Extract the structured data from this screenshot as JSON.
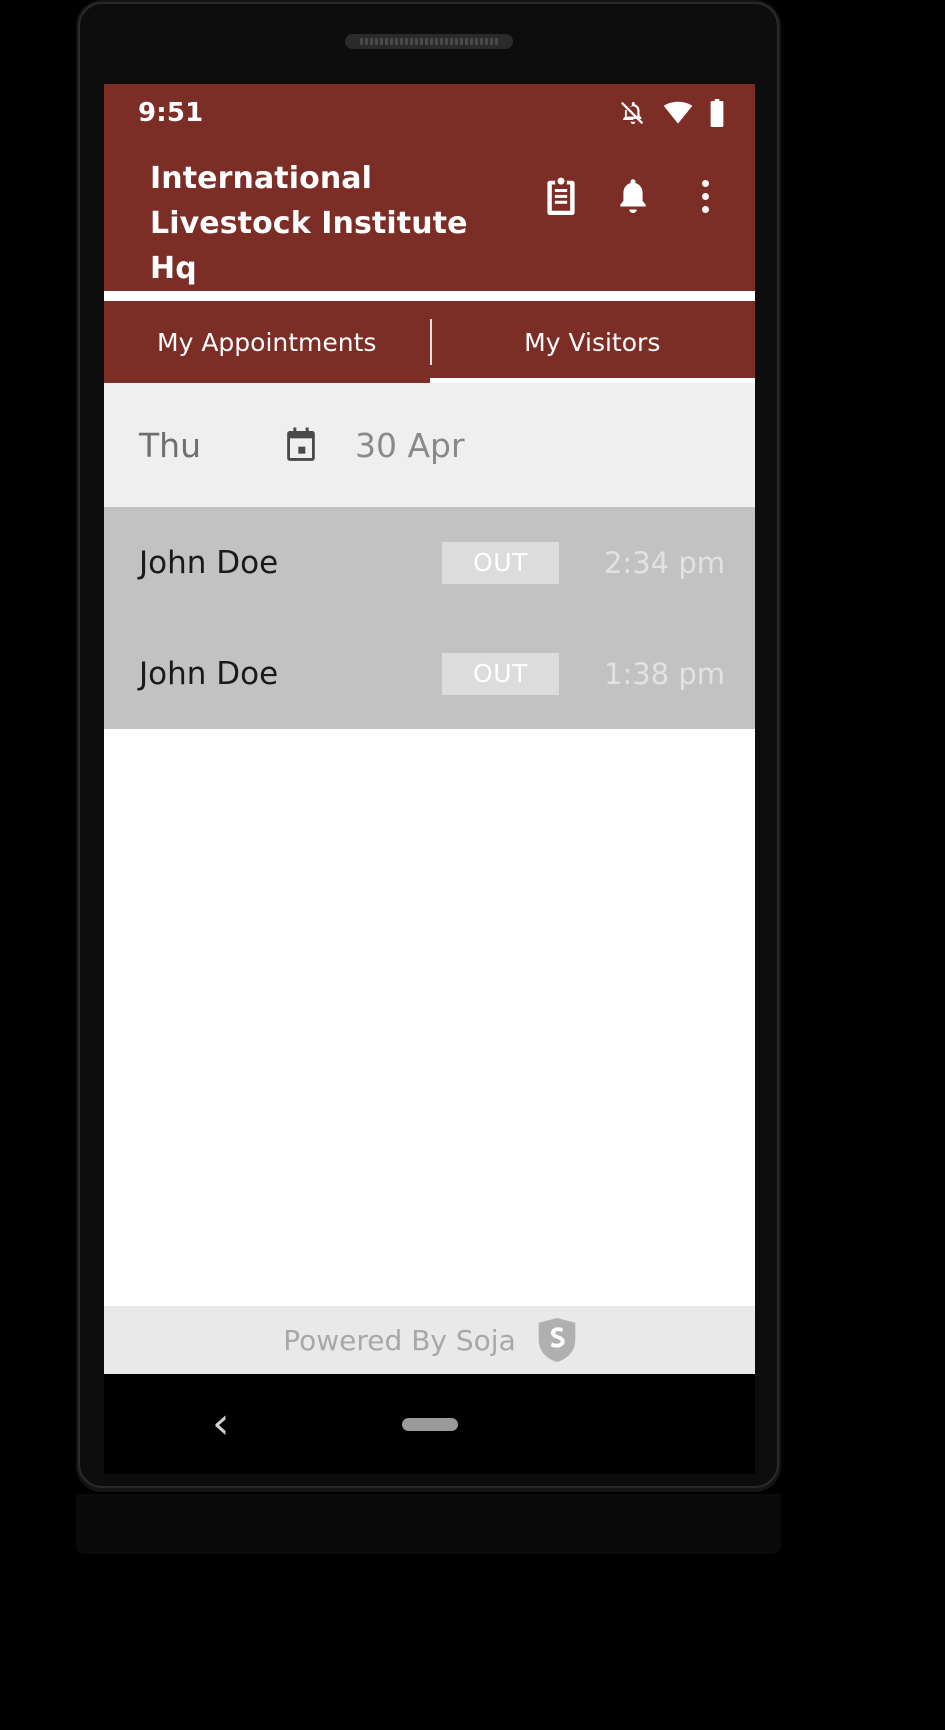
{
  "theme": {
    "brand_color": "#7B2D26",
    "row_bg": "#C2C2C2",
    "badge_bg": "#DCDCDC",
    "date_bg": "#EFEFEF",
    "footer_bg": "#E9E9E9"
  },
  "status_bar": {
    "clock": "9:51",
    "icons": [
      {
        "name": "notifications-off-icon"
      },
      {
        "name": "wifi-icon"
      },
      {
        "name": "battery-full-icon"
      }
    ]
  },
  "app_bar": {
    "title": "International Livestock Institute Hq",
    "actions": [
      {
        "name": "clipboard-icon",
        "label": "Clipboard"
      },
      {
        "name": "bell-icon",
        "label": "Notifications"
      },
      {
        "name": "overflow-menu-icon",
        "label": "More options"
      }
    ]
  },
  "tabs": [
    {
      "label": "My Appointments",
      "active": false
    },
    {
      "label": "My Visitors",
      "active": true
    }
  ],
  "date_header": {
    "day": "Thu",
    "calendar_icon": "calendar-icon",
    "date": "30 Apr"
  },
  "visitors": [
    {
      "name": "John Doe",
      "status": "OUT",
      "time": "2:34 pm"
    },
    {
      "name": "John Doe",
      "status": "OUT",
      "time": "1:38 pm"
    }
  ],
  "footer": {
    "text": "Powered By Soja",
    "logo": "soja-shield-logo",
    "logo_letter": "S"
  },
  "nav_bar": {
    "back": "‹",
    "home_pill": "home-indicator"
  }
}
